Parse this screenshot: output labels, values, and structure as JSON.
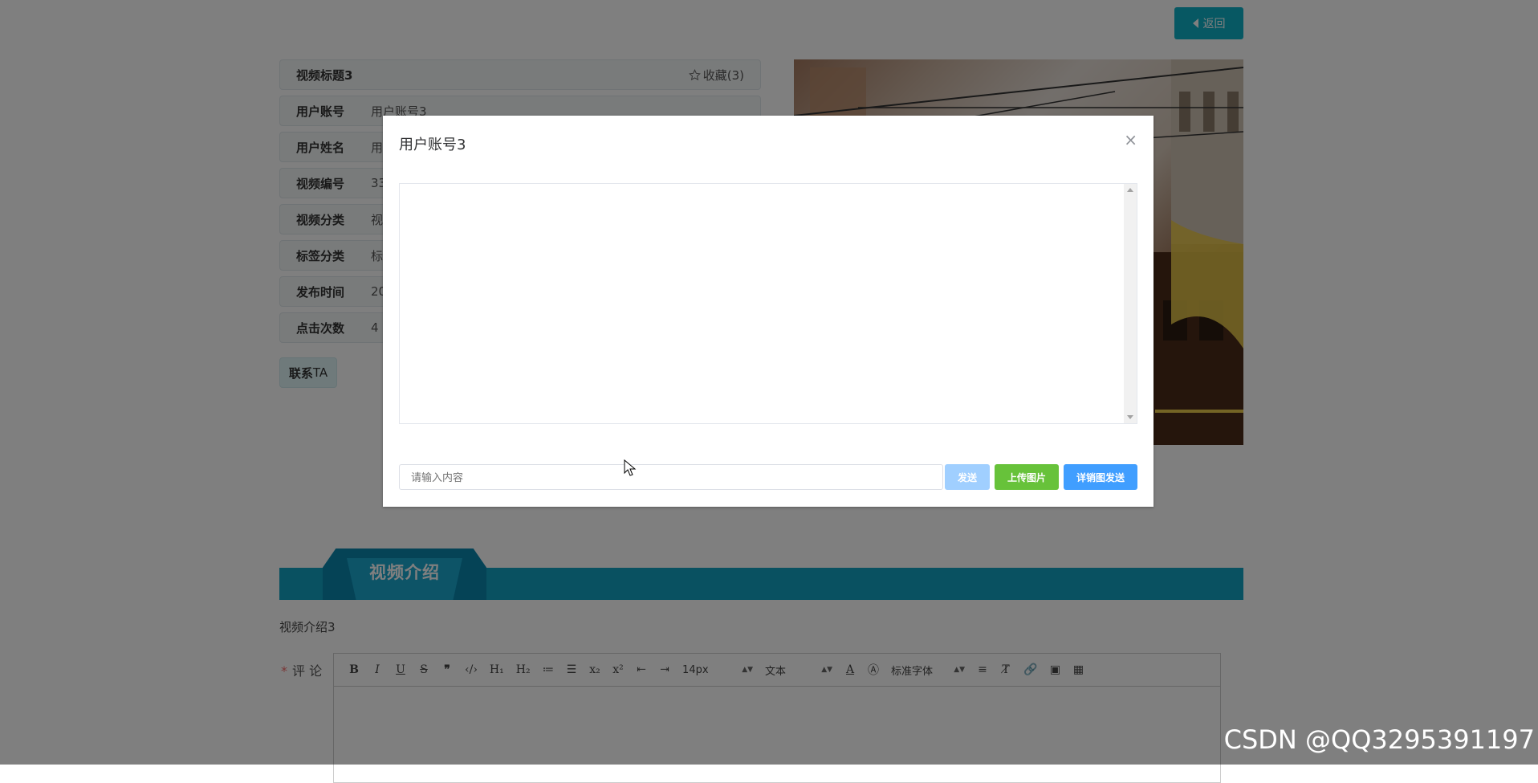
{
  "header": {
    "back_label": "返回"
  },
  "info": {
    "title": "视频标题3",
    "favorite_label": "收藏(3)",
    "rows": [
      {
        "label": "用户账号",
        "value": "用户账号3"
      },
      {
        "label": "用户姓名",
        "value": "用"
      },
      {
        "label": "视频编号",
        "value": "33"
      },
      {
        "label": "视频分类",
        "value": "视"
      },
      {
        "label": "标签分类",
        "value": "标"
      },
      {
        "label": "发布时间",
        "value": "20"
      },
      {
        "label": "点击次数",
        "value": "4"
      }
    ],
    "contact_label_main": "联系",
    "contact_label_suffix": "TA"
  },
  "intro": {
    "tab_label": "视频介绍",
    "content": "视频介绍3"
  },
  "comment": {
    "required_mark": "*",
    "label": "评 论",
    "toolbar": {
      "font_size": "14px",
      "text_style": "文本",
      "font_family": "标准字体"
    }
  },
  "modal": {
    "title": "用户账号3",
    "close": "×",
    "input_placeholder": "请输入内容",
    "send_label": "发送",
    "upload_label": "上传图片",
    "detail_send_label": "详销图发送"
  },
  "watermark": "CSDN @QQ3295391197",
  "colors": {
    "accent": "#12a3c3",
    "send": "#a0cfff",
    "upload": "#67c23a",
    "detail": "#409eff"
  }
}
